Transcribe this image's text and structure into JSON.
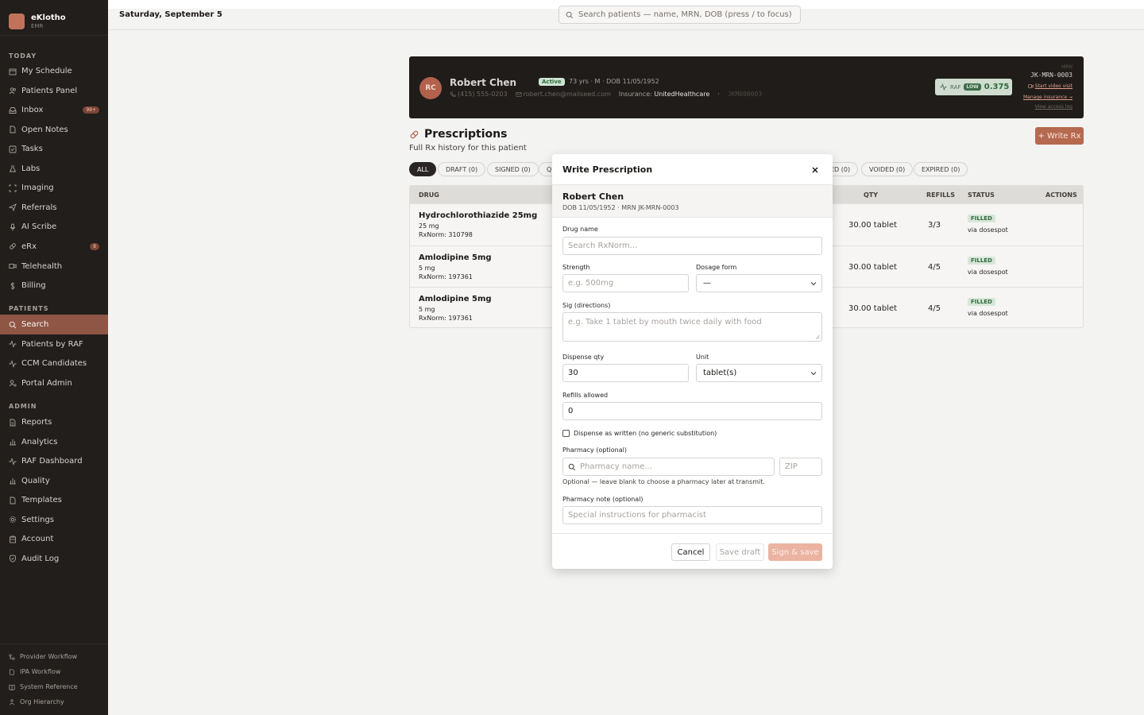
{
  "brand": {
    "name": "eKlotho",
    "sub": "EMR"
  },
  "sidebar": {
    "today_label": "TODAY",
    "today_items": [
      {
        "label": "My Schedule",
        "icon": "calendar-icon"
      },
      {
        "label": "Patients Panel",
        "icon": "users-icon"
      },
      {
        "label": "Inbox",
        "icon": "inbox-icon",
        "badge": "99+"
      },
      {
        "label": "Open Notes",
        "icon": "file-icon"
      },
      {
        "label": "Tasks",
        "icon": "checkbox-icon"
      },
      {
        "label": "Labs",
        "icon": "flask-icon"
      },
      {
        "label": "Imaging",
        "icon": "scan-icon"
      },
      {
        "label": "Referrals",
        "icon": "send-icon"
      },
      {
        "label": "AI Scribe",
        "icon": "mic-icon"
      },
      {
        "label": "eRx",
        "icon": "pill-icon",
        "badge": "8"
      },
      {
        "label": "Telehealth",
        "icon": "video-icon"
      },
      {
        "label": "Billing",
        "icon": "dollar-icon"
      }
    ],
    "patients_label": "PATIENTS",
    "patients_items": [
      {
        "label": "Search",
        "icon": "search-icon",
        "active": true
      },
      {
        "label": "Patients by RAF",
        "icon": "activity-icon"
      },
      {
        "label": "CCM Candidates",
        "icon": "activity-icon"
      },
      {
        "label": "Portal Admin",
        "icon": "user-cog-icon"
      }
    ],
    "admin_label": "ADMIN",
    "admin_items": [
      {
        "label": "Reports",
        "icon": "file-text-icon"
      },
      {
        "label": "Analytics",
        "icon": "bar-chart-icon"
      },
      {
        "label": "RAF Dashboard",
        "icon": "activity-icon"
      },
      {
        "label": "Quality",
        "icon": "bar-chart-icon"
      },
      {
        "label": "Templates",
        "icon": "file-icon"
      },
      {
        "label": "Settings",
        "icon": "gear-icon"
      },
      {
        "label": "Account",
        "icon": "building-icon"
      },
      {
        "label": "Audit Log",
        "icon": "shield-icon"
      }
    ],
    "footer_items": [
      {
        "label": "Provider Workflow",
        "icon": "workflow-icon"
      },
      {
        "label": "IPA Workflow",
        "icon": "file-icon"
      },
      {
        "label": "System Reference",
        "icon": "book-icon"
      },
      {
        "label": "Org Hierarchy",
        "icon": "org-icon"
      }
    ]
  },
  "topbar": {
    "date": "Saturday, September 5",
    "search_placeholder": "Search patients — name, MRN, DOB (press / to focus)"
  },
  "patient": {
    "initials": "RC",
    "name": "Robert Chen",
    "status": "Active",
    "demographics": "73 yrs · M · DOB 11/05/1952",
    "phone": "(415) 555-0203",
    "email": "robert.chen@mailseed.com",
    "insurance_label": "Insurance:",
    "insurance": "UnitedHealthcare",
    "member_id": "JKM000003",
    "raf_label": "RAF",
    "raf_level": "LOW",
    "raf_score": "0.375",
    "mrn_label": "MRN",
    "mrn": "JK-MRN-0003",
    "start_video": "Start video visit",
    "manage_insurance": "Manage insurance →",
    "view_access_log": "View access log"
  },
  "prescriptions": {
    "title": "Prescriptions",
    "subtitle": "Full Rx history for this patient",
    "write_button": "+ Write Rx",
    "filters": [
      "ALL",
      "DRAFT (0)",
      "SIGNED (0)",
      "Q",
      "ED (0)",
      "VOIDED (0)",
      "EXPIRED (0)"
    ],
    "columns": {
      "drug": "DRUG",
      "qty": "QTY",
      "refills": "REFILLS",
      "status": "STATUS",
      "actions": "ACTIONS"
    },
    "rows": [
      {
        "drug": "Hydrochlorothiazide 25mg",
        "strength": "25 mg",
        "rxnorm": "RxNorm: 310798",
        "qty": "30.00 tablet",
        "refills": "3/3",
        "status": "FILLED",
        "via": "via dosespot"
      },
      {
        "drug": "Amlodipine 5mg",
        "strength": "5 mg",
        "rxnorm": "RxNorm: 197361",
        "qty": "30.00 tablet",
        "refills": "4/5",
        "status": "FILLED",
        "via": "via dosespot"
      },
      {
        "drug": "Amlodipine 5mg",
        "strength": "5 mg",
        "rxnorm": "RxNorm: 197361",
        "qty": "30.00 tablet",
        "refills": "4/5",
        "status": "FILLED",
        "via": "via dosespot"
      }
    ]
  },
  "modal": {
    "title": "Write Prescription",
    "patient_name": "Robert Chen",
    "patient_meta": "DOB 11/05/1952 · MRN JK-MRN-0003",
    "drug_label": "Drug name",
    "drug_placeholder": "Search RxNorm...",
    "strength_label": "Strength",
    "strength_placeholder": "e.g. 500mg",
    "form_label": "Dosage form",
    "form_value": "—",
    "sig_label": "Sig (directions)",
    "sig_placeholder": "e.g. Take 1 tablet by mouth twice daily with food",
    "qty_label": "Dispense qty",
    "qty_value": "30",
    "unit_label": "Unit",
    "unit_value": "tablet(s)",
    "refills_label": "Refills allowed",
    "refills_value": "0",
    "daw_label": "Dispense as written (no generic substitution)",
    "pharmacy_label": "Pharmacy (optional)",
    "pharmacy_placeholder": "Pharmacy name...",
    "zip_placeholder": "ZIP",
    "pharmacy_helper": "Optional — leave blank to choose a pharmacy later at transmit.",
    "note_label": "Pharmacy note (optional)",
    "note_placeholder": "Special instructions for pharmacist",
    "cancel": "Cancel",
    "save_draft": "Save draft",
    "sign_save": "Sign & save"
  }
}
